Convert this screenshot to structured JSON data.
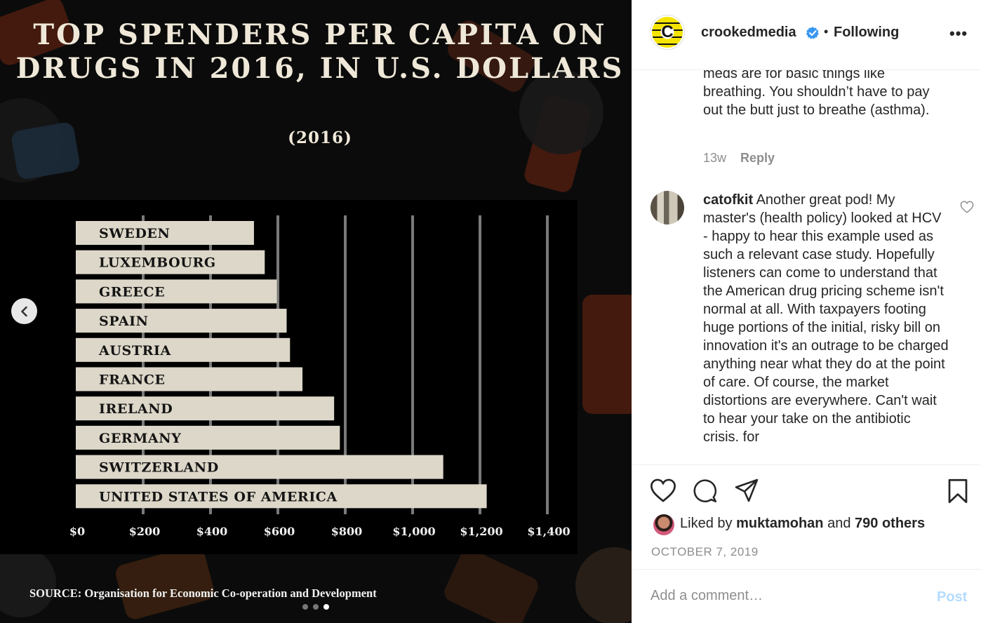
{
  "post_image": {
    "title": "TOP SPENDERS PER CAPITA ON DRUGS IN 2016, IN U.S. DOLLARS",
    "subtitle": "(2016)",
    "source": "SOURCE: Organisation for Economic Co-operation and Development",
    "carousel": {
      "total": 3,
      "active": 3
    },
    "colors": {
      "bar": "#ddd7c9",
      "bar_text": "#141414",
      "grid": "#7a7a7a",
      "axis_text": "#f0f0f0",
      "background": "#000000"
    }
  },
  "chart_data": {
    "type": "bar",
    "orientation": "horizontal",
    "categories": [
      "SWEDEN",
      "LUXEMBOURG",
      "GREECE",
      "SPAIN",
      "AUSTRIA",
      "FRANCE",
      "IRELAND",
      "GERMANY",
      "SWITZERLAND",
      "UNITED STATES OF AMERICA"
    ],
    "values": [
      529,
      561,
      597,
      626,
      636,
      673,
      767,
      784,
      1091,
      1220
    ],
    "title": "TOP SPENDERS PER CAPITA ON DRUGS IN 2016, IN U.S. DOLLARS",
    "subtitle": "(2016)",
    "xlabel": "",
    "ylabel": "",
    "xlim": [
      0,
      1400
    ],
    "x_ticks": [
      "$0",
      "$200",
      "$400",
      "$600",
      "$800",
      "$1,000",
      "$1,200",
      "$1,400"
    ],
    "grid": "vertical"
  },
  "side": {
    "header": {
      "username": "crookedmedia",
      "bullet": "•",
      "following_label": "Following",
      "more_label": "•••",
      "avatar_letter": "C"
    },
    "comments": [
      {
        "text": "meds are for basic things like breathing. You shouldn’t have to pay out the butt just to breathe (asthma).",
        "age": "13w",
        "reply_label": "Reply"
      },
      {
        "username": "catofkit",
        "text": "Another great pod! My master's (health policy) looked at HCV - happy to hear this example used as such a relevant case study. Hopefully listeners can come to understand that the American drug pricing scheme isn't normal at all. With taxpayers footing huge portions of the initial, risky bill on innovation it's an outrage to be charged anything near what they do at the point of care. Of course, the market distortions are everywhere. Can't wait to hear your take on the antibiotic crisis. for"
      }
    ],
    "likes": {
      "prefix": "Liked by",
      "user": "muktamohan",
      "middle": "and",
      "others": "790 others"
    },
    "date": "OCTOBER 7, 2019",
    "comment_box": {
      "placeholder": "Add a comment…",
      "post_label": "Post"
    }
  }
}
